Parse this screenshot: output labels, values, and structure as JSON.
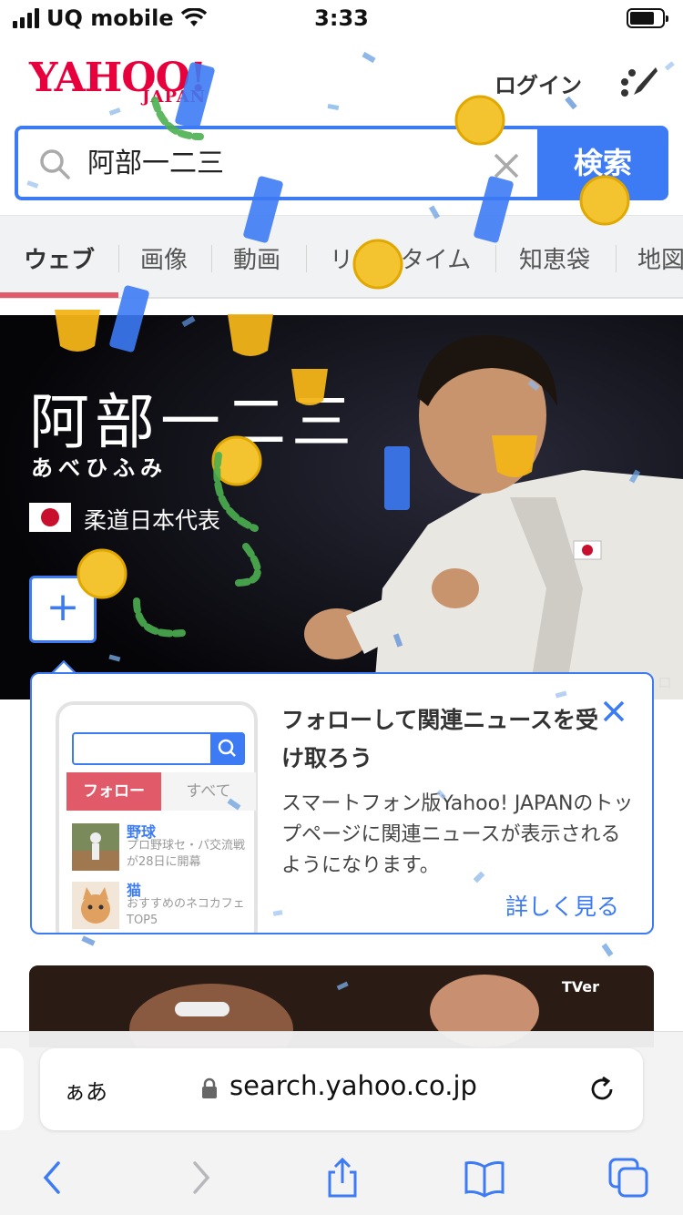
{
  "status": {
    "carrier": "UQ mobile",
    "time": "3:33"
  },
  "header": {
    "logo": "YAHOO!",
    "logo_sub": "JAPAN",
    "login": "ログイン"
  },
  "search": {
    "value": "阿部一二三",
    "button": "検索"
  },
  "tabs": [
    "ウェブ",
    "画像",
    "動画",
    "リアルタイム",
    "知恵袋",
    "地図"
  ],
  "hero": {
    "name": "阿部一二三",
    "reading": "あべひふみ",
    "team": "柔道日本代表",
    "follow": "+",
    "credit": "ロ"
  },
  "popup": {
    "title": "フォローして関連ニュースを受け取ろう",
    "body": "スマートフォン版Yahoo! JAPANのトップページに関連ニュースが表示されるようになります。",
    "more": "詳しく見る",
    "mock": {
      "tab_follow": "フォロー",
      "tab_all": "すべて",
      "items": [
        {
          "title": "野球",
          "desc": "プロ野球セ・パ交流戦が28日に開幕"
        },
        {
          "title": "猫",
          "desc": "おすすめのネコカフェTOP5"
        }
      ]
    }
  },
  "news": {
    "brand": "TVer"
  },
  "browser": {
    "aa": "ぁあ",
    "url": "search.yahoo.co.jp"
  },
  "colors": {
    "accent": "#3d7bf5",
    "brand": "#e8003d",
    "tab_active": "#e05a6a"
  }
}
